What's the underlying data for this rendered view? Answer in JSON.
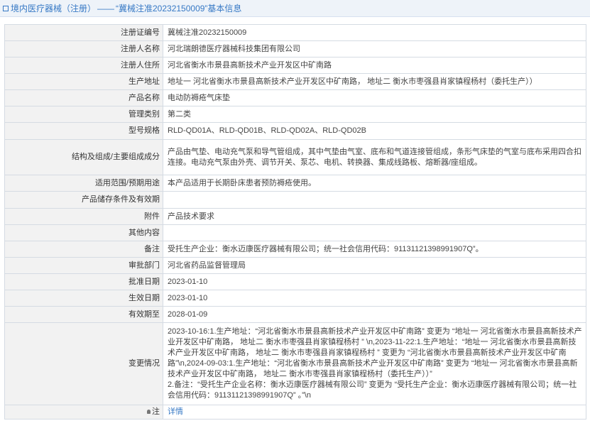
{
  "breadcrumb": {
    "section": "境内医疗器械（注册）",
    "separator": "——",
    "current": "“冀械注准20232150009”基本信息"
  },
  "rows": [
    {
      "label": "注册证编号",
      "value": "冀械注准20232150009"
    },
    {
      "label": "注册人名称",
      "value": "河北瑞朗德医疗器械科技集团有限公司"
    },
    {
      "label": "注册人住所",
      "value": "河北省衡水市景县高新技术产业开发区中矿南路"
    },
    {
      "label": "生产地址",
      "value": "地址一 河北省衡水市景县高新技术产业开发区中矿南路， 地址二 衡水市枣强县肖家镇程杨村（委托生产））"
    },
    {
      "label": "产品名称",
      "value": "电动防褥疮气床垫"
    },
    {
      "label": "管理类别",
      "value": "第二类"
    },
    {
      "label": "型号规格",
      "value": "RLD-QD01A、RLD-QD01B、RLD-QD02A、RLD-QD02B"
    },
    {
      "label": "结构及组成/主要组成成分",
      "value": "产品由气垫、电动充气泵和导气管组成，其中气垫由气室、底布和气道连接管组成，条形气床垫的气室与底布采用四合扣连接。电动充气泵由外壳、调节开关、泵芯、电机、转换器、集成线路板、熔断器/座组成。"
    },
    {
      "label": "适用范围/预期用途",
      "value": "本产品适用于长期卧床患者预防褥疮使用。"
    },
    {
      "label": "产品储存条件及有效期",
      "value": ""
    },
    {
      "label": "附件",
      "value": "产品技术要求"
    },
    {
      "label": "其他内容",
      "value": ""
    },
    {
      "label": "备注",
      "value": "受托生产企业：衡水迈康医疗器械有限公司；统一社会信用代码：91131121398991907Q”。"
    },
    {
      "label": "审批部门",
      "value": "河北省药品监督管理局"
    },
    {
      "label": "批准日期",
      "value": "2023-01-10"
    },
    {
      "label": "生效日期",
      "value": "2023-01-10"
    },
    {
      "label": "有效期至",
      "value": "2028-01-09"
    },
    {
      "label": "变更情况",
      "value": "2023-10-16:1.生产地址：“河北省衡水市景县高新技术产业开发区中矿南路” 变更为 “地址一 河北省衡水市景县高新技术产业开发区中矿南路， 地址二 衡水市枣强县肖家镇程杨村 ” \\n,2023-11-22:1.生产地址：“地址一 河北省衡水市景县高新技术产业开发区中矿南路， 地址二 衡水市枣强县肖家镇程杨村 ” 变更为 “河北省衡水市景县高新技术产业开发区中矿南路”\\n,2024-09-03:1.生产地址：“河北省衡水市景县高新技术产业开发区中矿南路” 变更为 “地址一 河北省衡水市景县高新技术产业开发区中矿南路， 地址二 衡水市枣强县肖家镇程杨村（委托生产））”\n2.备注：“受托生产企业名称：衡水迈康医疗器械有限公司” 变更为 “受托生产企业：衡水迈康医疗器械有限公司；统一社会信用代码：91131121398991907Q” 。”\\n"
    }
  ],
  "detail_link": "详情"
}
